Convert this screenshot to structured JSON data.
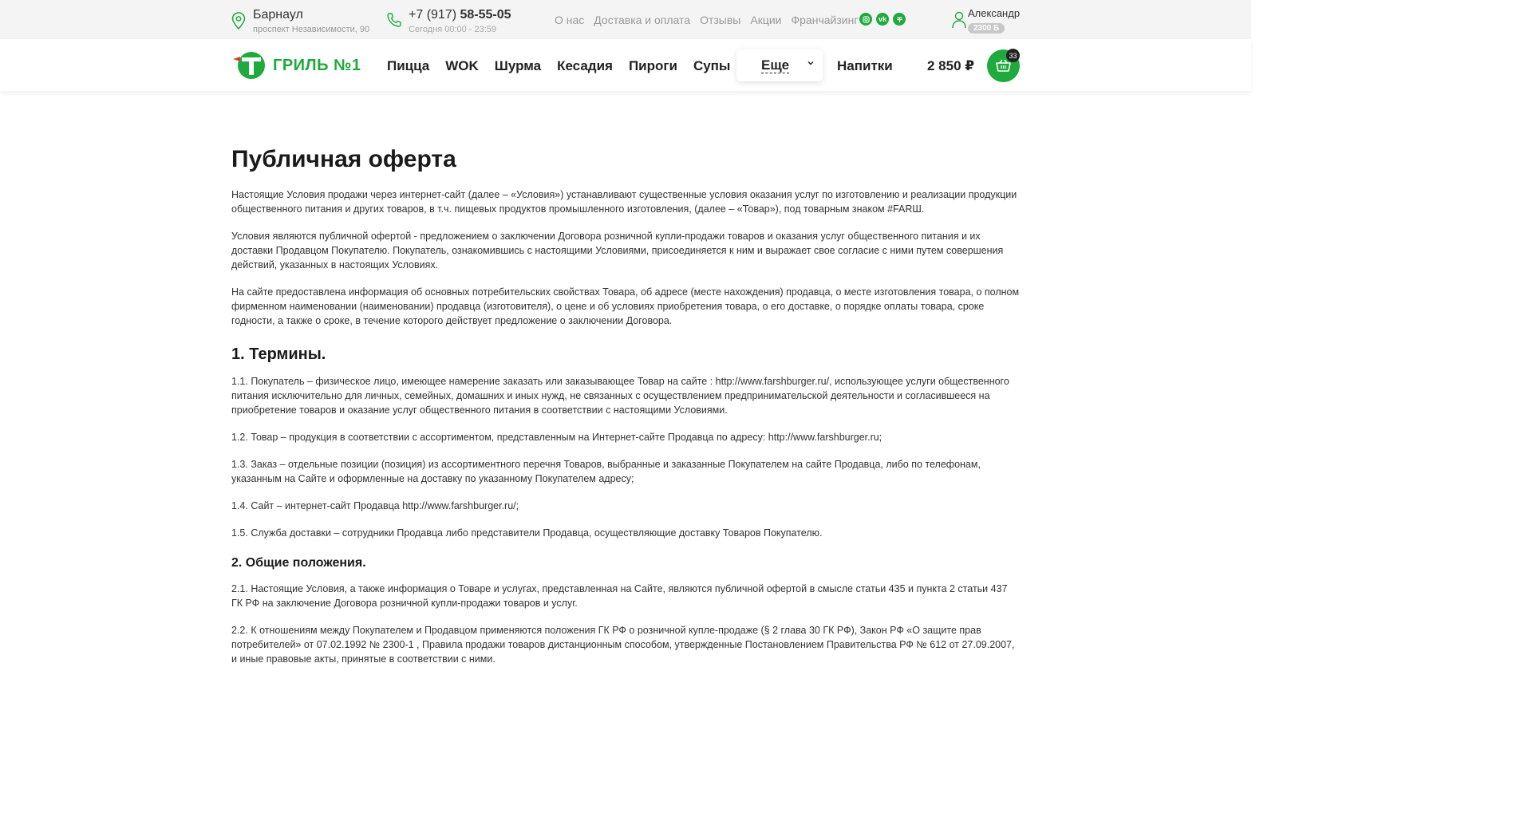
{
  "topbar": {
    "city": "Барнаул",
    "address": "проспект Независимости, 90",
    "phone_prefix": "+7 (917)",
    "phone_main": "58-55-05",
    "hours": "Сегодня 00:00 - 23:59",
    "links": [
      "О нас",
      "Доставка и оплата",
      "Отзывы",
      "Акции",
      "Франчайзинг"
    ],
    "socials": [
      "instagram-icon",
      "vk-icon",
      "tiktok-icon"
    ],
    "user_name": "Александр",
    "user_bonus": "2300 Б"
  },
  "nav": {
    "logo_text": "ГРИЛЬ №1",
    "items": [
      "Пицца",
      "WOK",
      "Шурма",
      "Кесадия",
      "Пироги",
      "Супы"
    ],
    "more_label": "Еще",
    "drinks_label": "Напитки",
    "cart_total": "2 850 ₽",
    "cart_count": "33"
  },
  "colors": {
    "accent": "#1eaa3c",
    "text": "#222222",
    "muted": "#999999"
  },
  "page": {
    "title": "Публичная оферта",
    "intro": [
      "Настоящие Условия продажи через интернет-сайт (далее – «Условия») устанавливают существенные условия оказания услуг по изготовлению и реализации продукции общественного питания и других товаров, в т.ч. пищевых продуктов промышленного изготовления, (далее – «Товар»), под товарным знаком #FARШ.",
      "Условия являются публичной офертой - предложением о заключении Договора розничной купли-продажи товаров и оказания услуг общественного питания и их доставки Продавцом Покупателю. Покупатель, ознакомившись с настоящими Условиями, присоединяется к ним и выражает свое согласие с ними путем совершения действий, указанных в настоящих Условиях.",
      "На сайте предоставлена информация об основных потребительских свойствах Товара, об адресе (месте нахождения) продавца, о месте изготовления товара, о полном фирменном наименовании (наименовании) продавца (изготовителя), о цене и об условиях приобретения товара, о его доставке, о порядке оплаты товара, сроке годности, а также о сроке, в течение которого действует предложение о заключении Договора."
    ],
    "section1_title": "1. Термины.",
    "section1": [
      "1.1. Покупатель – физическое лицо, имеющее намерение заказать или заказывающее Товар на сайте : http://www.farshburger.ru/, использующее услуги общественного питания исключительно для личных, семейных, домашних и иных нужд, не связанных с осуществлением предпринимательской деятельности и согласившееся на приобретение товаров и оказание услуг общественного питания в соответствии с настоящими Условиями.",
      "1.2. Товар – продукция в соответствии с ассортиментом, представленным на Интернет-сайте Продавца по адресу: http://www.farshburger.ru;",
      "1.3. Заказ – отдельные позиции (позиция) из ассортиментного перечня Товаров, выбранные и заказанные Покупателем на сайте Продавца, либо по телефонам, указанным на Сайте и оформленные на доставку по указанному Покупателем адресу;",
      "1.4. Сайт – интернет-сайт Продавца http://www.farshburger.ru/;",
      "1.5. Служба доставки – сотрудники Продавца либо представители Продавца, осуществляющие доставку Товаров Покупателю."
    ],
    "section2_title": "2. Общие положения.",
    "section2": [
      "2.1. Настоящие Условия, а также информация о Товаре и услугах, представленная на Сайте, являются публичной офертой в смысле статьи 435 и пункта 2 статьи 437 ГК РФ на заключение Договора розничной купли-продажи товаров и услуг.",
      "2.2. К отношениям между Покупателем и Продавцом применяются положения ГК РФ о розничной купле-продаже (§ 2 глава 30 ГК РФ), Закон РФ «О защите прав потребителей» от 07.02.1992 № 2300-1 , Правила продажи товаров дистанционным способом, утвержденные Постановлением Правительства РФ № 612 от 27.09.2007, и иные правовые акты, принятые в соответствии с ними."
    ]
  }
}
